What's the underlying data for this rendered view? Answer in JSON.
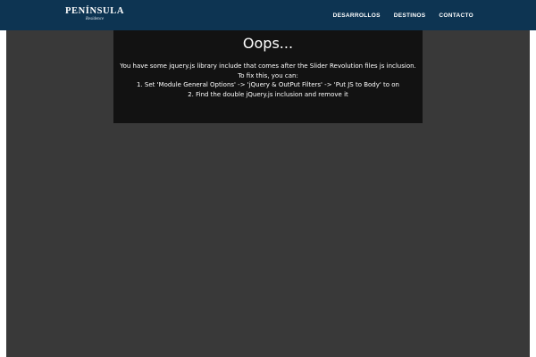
{
  "header": {
    "logo": {
      "title": "PENÍNSULA",
      "subtitle": "Residence"
    },
    "nav": [
      {
        "label": "DESARROLLOS"
      },
      {
        "label": "DESTINOS"
      },
      {
        "label": "CONTACTO"
      }
    ]
  },
  "error": {
    "title": "Oops...",
    "lines": [
      "You have some jquery.js library include that comes after the Slider Revolution files js inclusion.",
      "To fix this, you can:",
      "1. Set 'Module General Options' -> 'jQuery & OutPut Filters' -> 'Put JS to Body' to on",
      "2. Find the double jQuery.js inclusion and remove it"
    ]
  },
  "colors": {
    "header_bg": "#0d3452",
    "content_bg": "#393939",
    "error_bg": "#121212"
  }
}
